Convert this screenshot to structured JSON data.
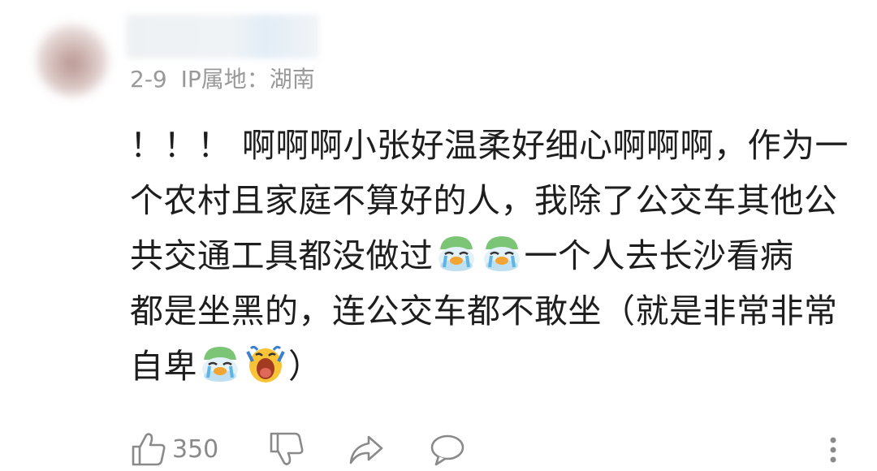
{
  "comment": {
    "date": "2-9",
    "ip_location": "IP属地：湖南",
    "lines": [
      "！！！ 啊啊啊小张好温柔好细心啊啊啊，作为一",
      "个农村且家庭不算好的人，我除了公交车其他公",
      [
        "共交通工具都没做过",
        "一个人去长沙看病"
      ],
      "都是坐黑的，连公交车都不敢坐（就是非常非常",
      [
        "自卑",
        "）"
      ]
    ],
    "emojis": [
      "crying-duck-emoji",
      "crying-duck-emoji",
      "crying-duck-emoji",
      "screaming-face-emoji"
    ]
  },
  "actions": {
    "like_count": "350"
  },
  "colors": {
    "text": "#1e1e1e",
    "meta": "#999999",
    "icon": "#8a8a8a"
  }
}
